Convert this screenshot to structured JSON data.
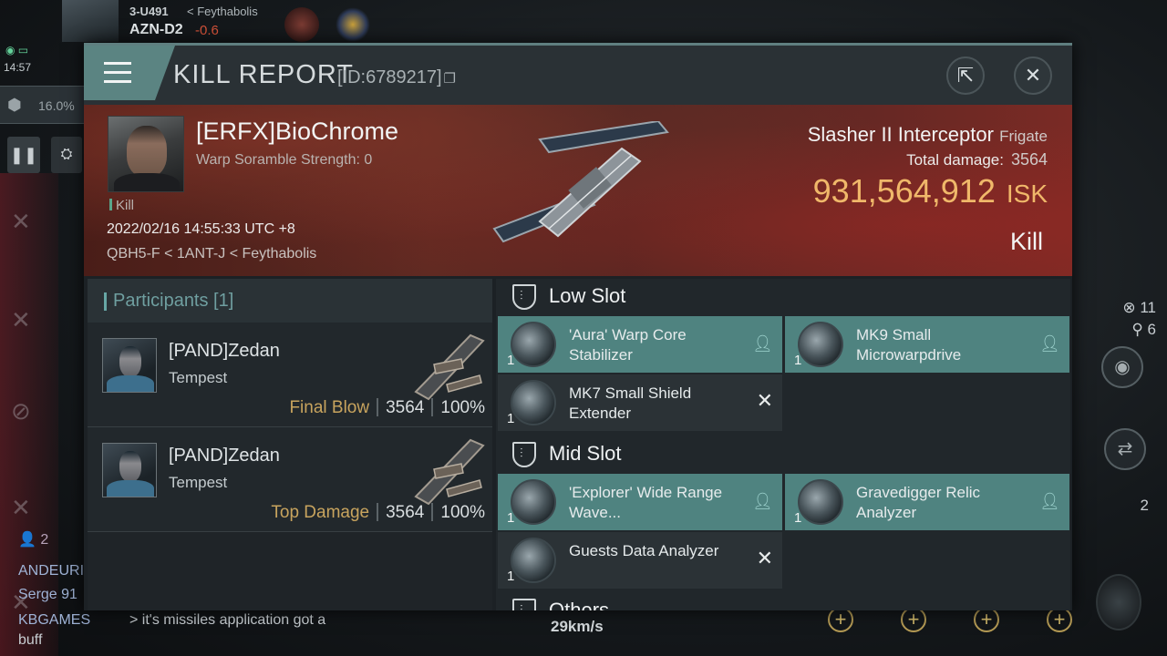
{
  "hud": {
    "system_path_a": "3-U491",
    "region": "Feythabolis",
    "current_system": "AZN-D2",
    "security": "-0.6",
    "clock": "14:57",
    "cargo_percent": "16.0%",
    "speed": "29km/s",
    "right_count_1": "11",
    "right_count_2": "6",
    "right_badge": "2",
    "local_count": "2"
  },
  "chat": {
    "lines": [
      {
        "name": "ANDEURI"
      },
      {
        "name": "Serge 91"
      },
      {
        "name": "KBGAMES"
      }
    ],
    "message": "> it's missiles application got a",
    "message_cont": "buff"
  },
  "window": {
    "title": "KILL REPORT",
    "report_id": "[ID:6789217]"
  },
  "victim": {
    "name": "[ERFX]BioChrome",
    "warp_scramble": "Warp Soramble Strength: 0",
    "kill_tag": "Kill",
    "datetime": "2022/02/16 14:55:33 UTC +8",
    "location": "QBH5-F < 1ANT-J < Feythabolis",
    "ship_name": "Slasher II Interceptor",
    "ship_class": "Frigate",
    "total_damage_label": "Total damage:",
    "total_damage": "3564",
    "isk_value": "931,564,912",
    "isk_unit": "ISK",
    "result": "Kill"
  },
  "participants": {
    "header": "Participants [1]",
    "rows": [
      {
        "name": "[PAND]Zedan",
        "ship": "Tempest",
        "role": "Final Blow",
        "damage": "3564",
        "percent": "100%"
      },
      {
        "name": "[PAND]Zedan",
        "ship": "Tempest",
        "role": "Top Damage",
        "damage": "3564",
        "percent": "100%"
      }
    ]
  },
  "fitting": {
    "low_slot_title": "Low Slot",
    "mid_slot_title": "Mid Slot",
    "others_title": "Others",
    "low_slot": [
      {
        "qty": "1",
        "name": "'Aura' Warp Core Stabilizer",
        "status": "dropped"
      },
      {
        "qty": "1",
        "name": "MK9 Small Microwarpdrive",
        "status": "dropped"
      },
      {
        "qty": "1",
        "name": "MK7 Small Shield Extender",
        "status": "destroyed"
      }
    ],
    "mid_slot": [
      {
        "qty": "1",
        "name": "'Explorer' Wide Range Wave...",
        "status": "dropped"
      },
      {
        "qty": "1",
        "name": "Gravedigger Relic Analyzer",
        "status": "dropped"
      },
      {
        "qty": "1",
        "name": "Guests Data Analyzer",
        "status": "destroyed"
      }
    ]
  },
  "colors": {
    "accent": "#5b8482",
    "isk": "#f0b86a",
    "final_blow": "#c8a45e",
    "banner": "#5b2a22"
  },
  "icons": {
    "menu": "hamburger-icon",
    "share": "external-link-icon",
    "close": "close-icon",
    "copy": "copy-icon",
    "dropped": "person-icon",
    "destroyed": "x-icon"
  }
}
